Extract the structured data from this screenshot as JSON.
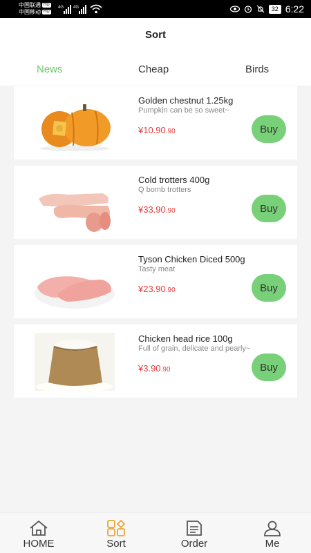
{
  "status_bar": {
    "carrier1": "中国联通",
    "carrier2": "中国移动",
    "hd": "HD",
    "network1": "4G",
    "network2": "4G",
    "battery": "32",
    "time": "6:22"
  },
  "header": {
    "title": "Sort",
    "tabs": [
      {
        "label": "News",
        "active": true
      },
      {
        "label": "Cheap",
        "active": false
      },
      {
        "label": "Birds",
        "active": false
      }
    ]
  },
  "products": [
    {
      "name": "Golden chestnut 1.25kg",
      "desc": "Pumpkin can be so sweet~",
      "price": "¥10.90",
      "cents": ".90",
      "buy": "Buy",
      "image": "pumpkin"
    },
    {
      "name": "Cold trotters 400g",
      "desc": "Q bomb trotters",
      "price": "¥33.90",
      "cents": ".90",
      "buy": "Buy",
      "image": "pig-trotters"
    },
    {
      "name": "Tyson Chicken Diced 500g",
      "desc": "Tasty meat",
      "price": "¥23.90",
      "cents": ".90",
      "buy": "Buy",
      "image": "chicken-breast"
    },
    {
      "name": "Chicken head rice 100g",
      "desc": "Full of grain, delicate and pearly~",
      "price": "¥3.90",
      "cents": ".90",
      "buy": "Buy",
      "image": "rice-sack"
    }
  ],
  "tabbar": [
    {
      "label": "HOME",
      "icon": "home-icon",
      "active": false
    },
    {
      "label": "Sort",
      "icon": "sort-icon",
      "active": true
    },
    {
      "label": "Order",
      "icon": "order-icon",
      "active": false
    },
    {
      "label": "Me",
      "icon": "user-icon",
      "active": false
    }
  ],
  "colors": {
    "accent": "#6cc76a",
    "buy_button": "#78d178",
    "price": "#e23c3c",
    "tab_active_icon": "#e8a43a"
  }
}
